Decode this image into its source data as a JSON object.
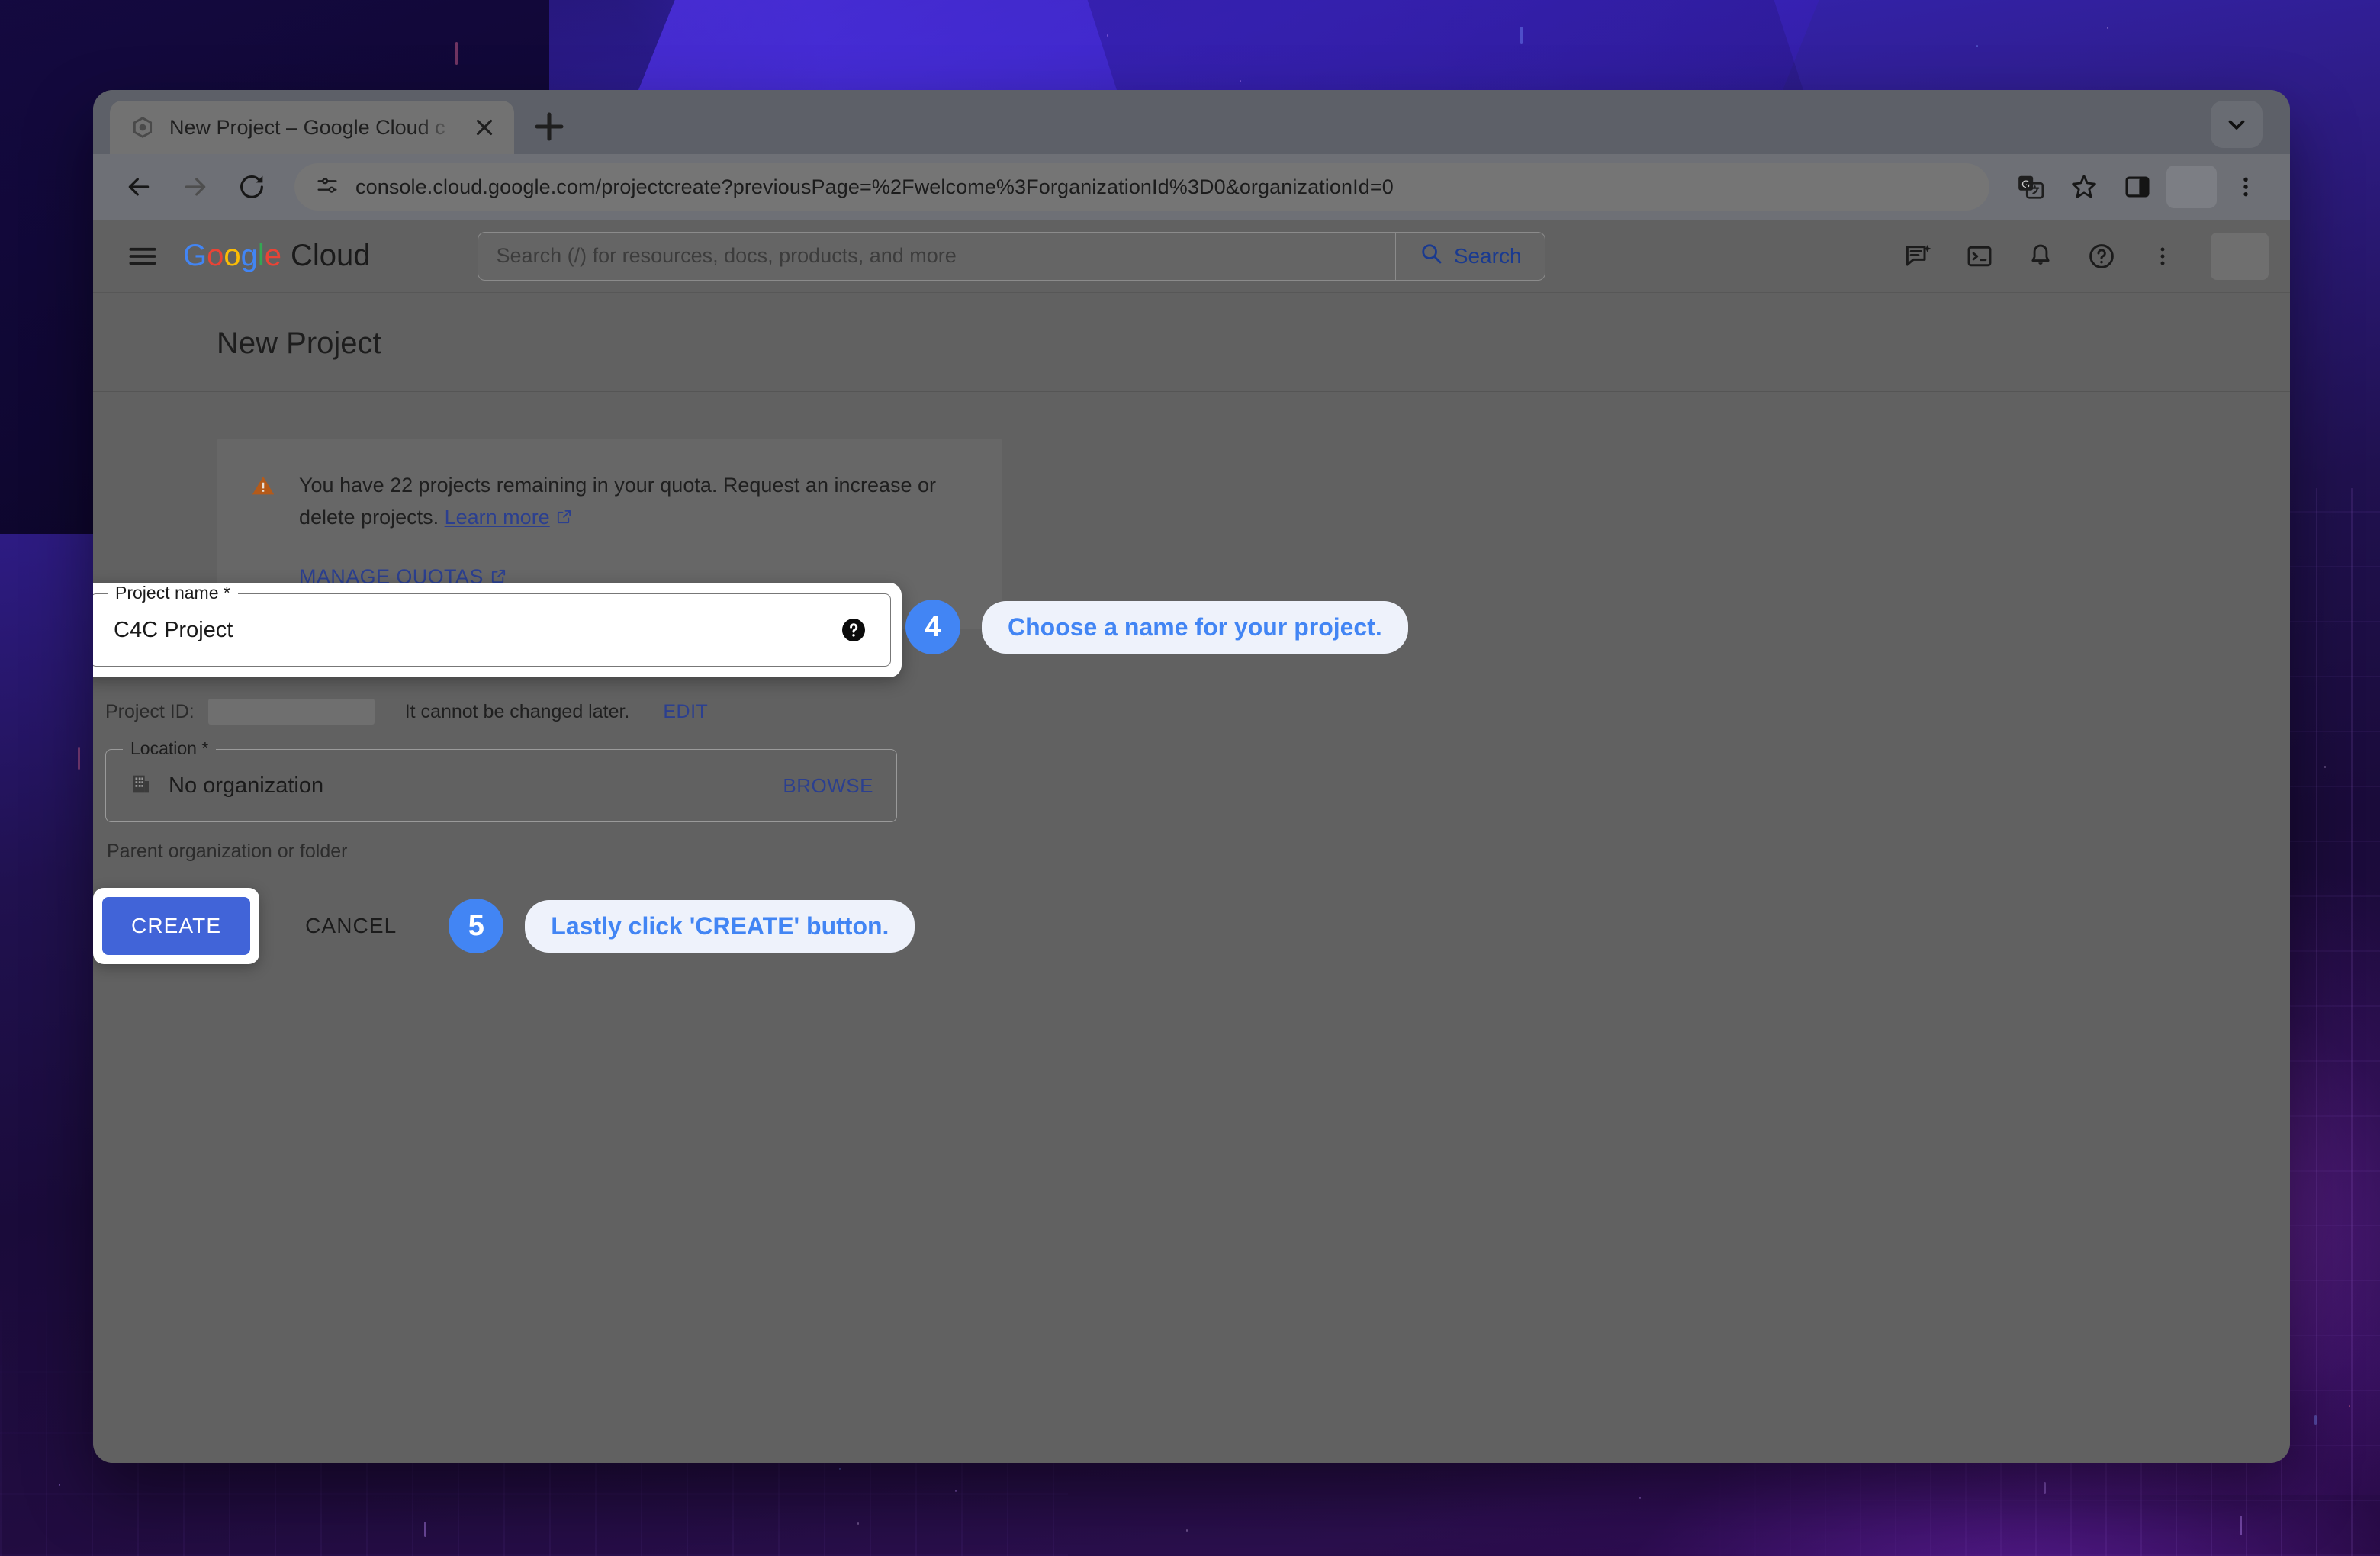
{
  "browser": {
    "tab": {
      "title": "New Project – Google Cloud c",
      "favicon_icon": "google-cloud-favicon",
      "close_icon": "close-icon"
    },
    "new_tab_icon": "plus-icon",
    "tab_list_icon": "chevron-down-icon",
    "nav": {
      "back_icon": "back-arrow-icon",
      "forward_icon": "forward-arrow-icon",
      "reload_icon": "reload-icon"
    },
    "omnibox": {
      "site_settings_icon": "tune-icon",
      "url": "console.cloud.google.com/projectcreate?previousPage=%2Fwelcome%3ForganizationId%3D0&organizationId=0"
    },
    "toolbar_icons": [
      "translate-icon",
      "bookmark-star-icon",
      "side-panel-icon",
      "profile-avatar",
      "chrome-menu-icon"
    ]
  },
  "cloud_header": {
    "menu_icon": "hamburger-menu-icon",
    "brand_google": "Google",
    "brand_cloud": "Cloud",
    "search": {
      "placeholder": "Search (/) for resources, docs, products, and more",
      "value": "",
      "button_label": "Search",
      "button_icon": "search-icon"
    },
    "actions": [
      "gemini-chat-icon",
      "cloud-shell-icon",
      "notifications-bell-icon",
      "help-icon",
      "more-options-icon"
    ],
    "avatar": "user-avatar"
  },
  "page": {
    "title": "New Project",
    "notice": {
      "warning_icon": "warning-triangle-icon",
      "text_line1": "You have 22 projects remaining in your quota. Request an increase or",
      "text_line2": "delete projects.",
      "learn_more": "Learn more",
      "learn_more_icon": "open-in-new-icon",
      "manage_quotas": "MANAGE QUOTAS",
      "manage_quotas_icon": "open-in-new-icon"
    },
    "project_name_field": {
      "label": "Project name *",
      "value": "C4C Project",
      "help_icon": "help-circle-icon"
    },
    "project_id": {
      "label": "Project ID:",
      "value": "",
      "note": "It cannot be changed later.",
      "edit_label": "EDIT"
    },
    "location_field": {
      "label": "Location *",
      "org_icon": "organization-building-icon",
      "value": "No organization",
      "browse_label": "BROWSE",
      "hint": "Parent organization or folder"
    },
    "buttons": {
      "create": "CREATE",
      "cancel": "CANCEL"
    }
  },
  "callouts": [
    {
      "step": "4",
      "text": "Choose a name for your project."
    },
    {
      "step": "5",
      "text": "Lastly click 'CREATE' button."
    }
  ],
  "colors": {
    "accent_blue": "#4285f4",
    "create_button": "#4164d8",
    "link_blue": "#2b3f8f",
    "warning_orange": "#b55a19",
    "page_dim": "#616161"
  }
}
